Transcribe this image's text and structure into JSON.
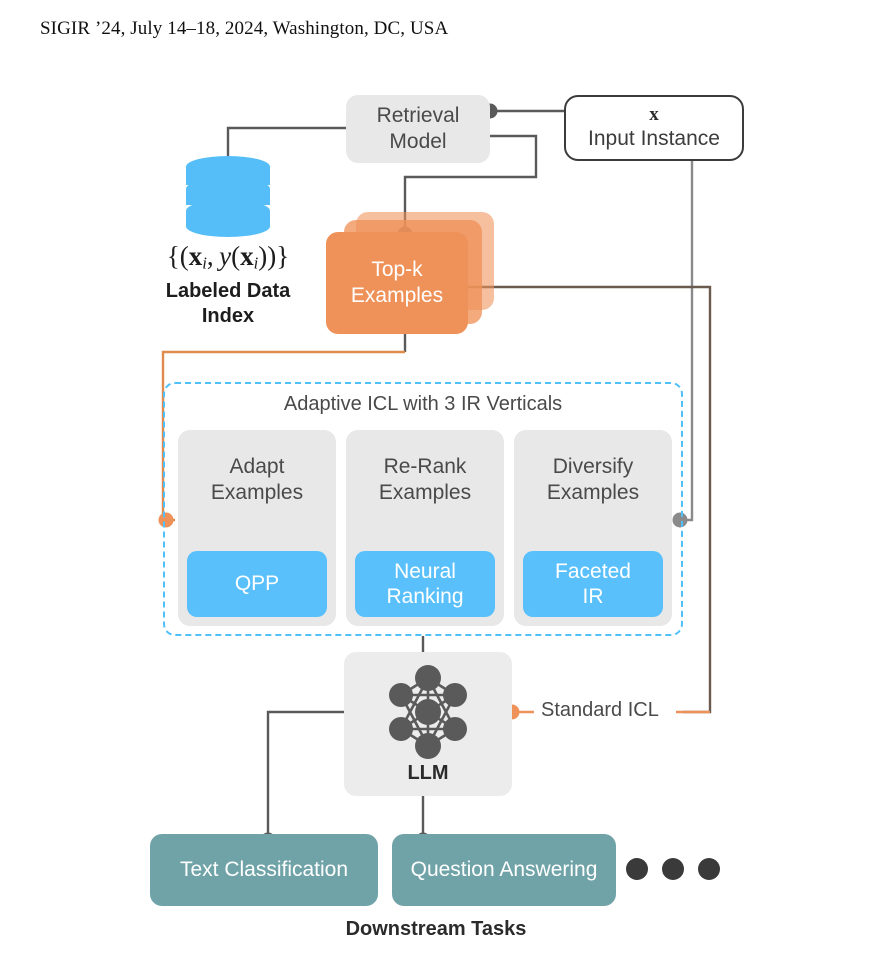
{
  "venue_header": "SIGIR ’24, July 14–18, 2024, Washington, DC, USA",
  "colors": {
    "orange": "#ef9259",
    "blue": "#59c0fb",
    "db_blue": "#55bdf7",
    "teal": "#6fa3a7",
    "grey_box": "#e8e8e8",
    "dark_grey": "#4a4a4a",
    "dashed_border": "#4fc0f8",
    "connector_grey": "#5a5a5a"
  },
  "nodes": {
    "retrieval_model": {
      "label": "Retrieval\nModel",
      "line1": "Retrieval",
      "line2": "Model"
    },
    "input_instance": {
      "symbol": "x",
      "label": "Input Instance"
    },
    "labeled_data_index": {
      "icon": "database-icon",
      "math": "{(x_i, y(x_i))}",
      "caption_line1": "Labeled Data",
      "caption_line2": "Index"
    },
    "topk_examples": {
      "line1": "Top-k",
      "line2": "Examples"
    },
    "llm": {
      "label": "LLM",
      "icon": "neural-network-icon"
    }
  },
  "adaptive_icl": {
    "title": "Adaptive ICL with 3 IR Verticals",
    "verticals": [
      {
        "title_line1": "Adapt",
        "title_line2": "Examples",
        "pill_line1": "QPP",
        "pill_line2": ""
      },
      {
        "title_line1": "Re-Rank",
        "title_line2": "Examples",
        "pill_line1": "Neural",
        "pill_line2": "Ranking"
      },
      {
        "title_line1": "Diversify",
        "title_line2": "Examples",
        "pill_line1": "Faceted",
        "pill_line2": "IR"
      }
    ]
  },
  "standard_icl": {
    "label": "Standard ICL"
  },
  "downstream": {
    "caption": "Downstream Tasks",
    "tasks": [
      {
        "label": "Text Classification"
      },
      {
        "label": "Question Answering"
      }
    ],
    "ellipsis": "•••"
  }
}
